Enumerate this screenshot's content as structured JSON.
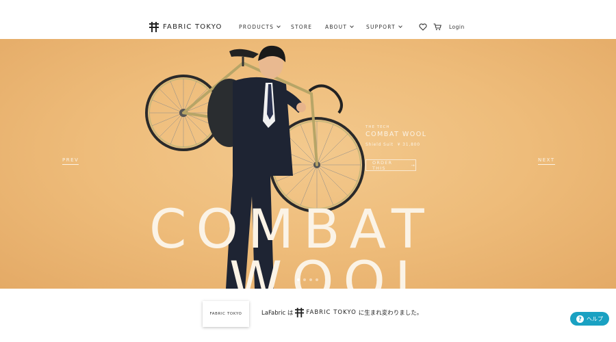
{
  "header": {
    "logo_text": "FABRIC TOKYO",
    "nav": [
      {
        "label": "PRODUCTS"
      },
      {
        "label": "STORE"
      },
      {
        "label": "ABOUT"
      },
      {
        "label": "SUPPORT"
      }
    ],
    "favorite_icon": "heart-icon",
    "cart_icon": "cart-icon",
    "login_label": "Login"
  },
  "hero": {
    "big_word_1": "COMBAT",
    "big_word_2": "WOOL",
    "prev_label": "PREV",
    "next_label": "NEXT",
    "promo": {
      "subtitle": "THE TECH",
      "title": "COMBAT WOOL",
      "item": "Shield Suit",
      "price": "¥ 31,800",
      "cta": "ORDER THIS"
    },
    "slides_total": 4,
    "active_slide": 1
  },
  "banner": {
    "card_text": "FABRIC TOKYO",
    "prefix": "LaFabric は",
    "brand": "FABRIC TOKYO",
    "suffix": "に生まれ変わりました。"
  },
  "help": {
    "label": "ヘルプ",
    "icon": "question-icon"
  },
  "colors": {
    "hero_bg": "#eebc7a",
    "hero_text": "#fbf3e6",
    "help_bg": "#1aa1c2"
  }
}
